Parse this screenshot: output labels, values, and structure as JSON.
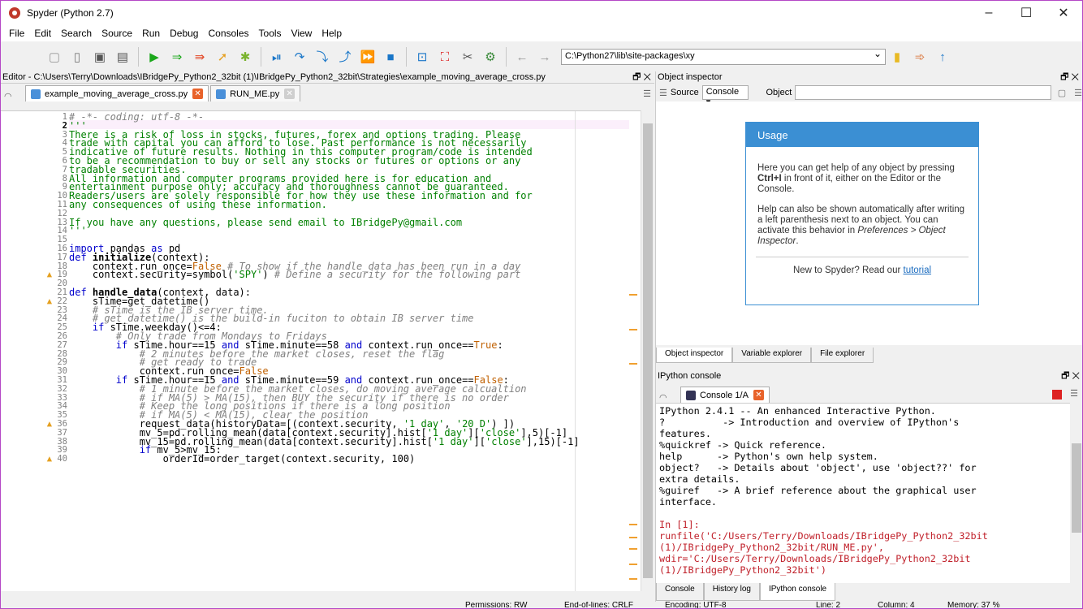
{
  "window": {
    "title": "Spyder (Python 2.7)",
    "controls": [
      "–",
      "☐",
      "✕"
    ]
  },
  "menu": [
    "File",
    "Edit",
    "Search",
    "Source",
    "Run",
    "Debug",
    "Consoles",
    "Tools",
    "View",
    "Help"
  ],
  "toolbar": {
    "path": "C:\\Python27\\lib\\site-packages\\xy"
  },
  "editor": {
    "title": "Editor - C:\\Users\\Terry\\Downloads\\IBridgePy_Python2_32bit (1)\\IBridgePy_Python2_32bit\\Strategies\\example_moving_average_cross.py",
    "tabs": [
      {
        "label": "example_moving_average_cross.py"
      },
      {
        "label": "RUN_ME.py"
      }
    ],
    "lines": [
      "# -*- coding: utf-8 -*-",
      "'''",
      "There is a risk of loss in stocks, futures, forex and options trading. Please",
      "trade with capital you can afford to lose. Past performance is not necessarily",
      "indicative of future results. Nothing in this computer program/code is intended",
      "to be a recommendation to buy or sell any stocks or futures or options or any",
      "tradable securities.",
      "All information and computer programs provided here is for education and",
      "entertainment purpose only; accuracy and thoroughness cannot be guaranteed.",
      "Readers/users are solely responsible for how they use these information and for",
      "any consequences of using these information.",
      "",
      "If you have any questions, please send email to IBridgePy@gmail.com",
      "'''",
      "",
      "import pandas as pd",
      "def initialize(context):",
      "    context.run_once=False # To show if the handle_data has been run in a day",
      "    context.security=symbol('SPY') # Define a security for the following part",
      "",
      "def handle_data(context, data):",
      "    sTime=get_datetime()",
      "    # sTime is the IB server time.",
      "    # get_datetime() is the build-in fuciton to obtain IB server time",
      "    if sTime.weekday()<=4:",
      "        # Only trade from Mondays to Fridays",
      "        if sTime.hour==15 and sTime.minute==58 and context.run_once==True:",
      "            # 2 minutes before the market closes, reset the flag",
      "            # get ready to trade",
      "            context.run_once=False",
      "        if sTime.hour==15 and sTime.minute==59 and context.run_once==False:",
      "            # 1 minute before the market closes, do moving average calcualtion",
      "            # if MA(5) > MA(15), then BUY the security if there is no order",
      "            # Keep the long positions if there is a long position",
      "            # if MA(5) < MA(15), clear the position",
      "            request_data(historyData=[(context.security, '1 day', '20 D') ])",
      "            mv_5=pd.rolling_mean(data[context.security].hist['1 day']['close'],5)[-1]",
      "            mv_15=pd.rolling_mean(data[context.security].hist['1 day']['close'],15)[-1]",
      "            if mv_5>mv_15:",
      "                orderId=order_target(context.security, 100)"
    ]
  },
  "object_inspector": {
    "title": "Object inspector",
    "source_label": "Source",
    "source_value": "Console ▾",
    "object_label": "Object",
    "usage": {
      "heading": "Usage",
      "p1a": "Here you can get help of any object by pressing ",
      "p1b": "Ctrl+I",
      "p1c": " in front of it, either on the Editor or the Console.",
      "p2a": "Help can also be shown automatically after writing a left parenthesis next to an object. You can activate this behavior in ",
      "p2b": "Preferences > Object Inspector",
      "p2c": ".",
      "foot": "New to Spyder? Read our ",
      "link": "tutorial"
    },
    "tabs": [
      "Object inspector",
      "Variable explorer",
      "File explorer"
    ]
  },
  "ipython": {
    "title": "IPython console",
    "tab": "Console 1/A",
    "text": "IPython 2.4.1 -- An enhanced Interactive Python.\n?          -> Introduction and overview of IPython's\nfeatures.\n%quickref -> Quick reference.\nhelp      -> Python's own help system.\nobject?   -> Details about 'object', use 'object??' for\nextra details.\n%guiref   -> A brief reference about the graphical user\ninterface.\n",
    "prompt": "In [1]:",
    "cmd": "runfile('C:/Users/Terry/Downloads/IBridgePy_Python2_32bit\n(1)/IBridgePy_Python2_32bit/RUN_ME.py',\nwdir='C:/Users/Terry/Downloads/IBridgePy_Python2_32bit\n(1)/IBridgePy_Python2_32bit')",
    "bottom_tabs": [
      "Console",
      "History log",
      "IPython console"
    ]
  },
  "status": {
    "permissions": "Permissions: RW",
    "eol": "End-of-lines: CRLF",
    "encoding": "Encoding: UTF-8",
    "line": "Line: 2",
    "column": "Column: 4",
    "memory": "Memory: 37 %"
  }
}
